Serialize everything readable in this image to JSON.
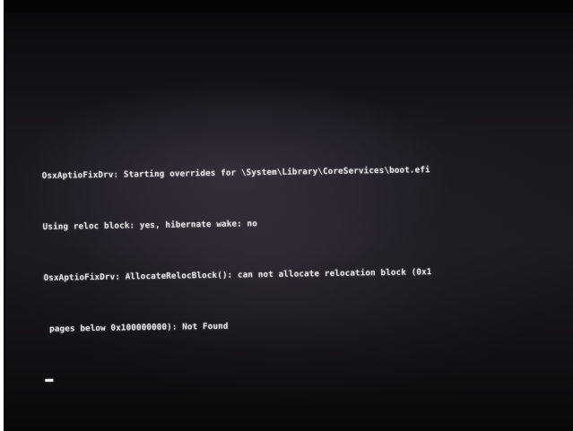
{
  "console": {
    "lines": [
      "OsxAptioFixDrv: Starting overrides for \\System\\Library\\CoreServices\\boot.efi",
      "Using reloc block: yes, hibernate wake: no",
      "OsxAptioFixDrv: AllocateRelocBlock(): can not allocate relocation block (0x1 ",
      " pages below 0x100000000): Not Found"
    ],
    "cursor": "_"
  },
  "colors": {
    "text": "#e8e6e8",
    "screen_background": "#1a181e",
    "bezel": "#050507"
  }
}
